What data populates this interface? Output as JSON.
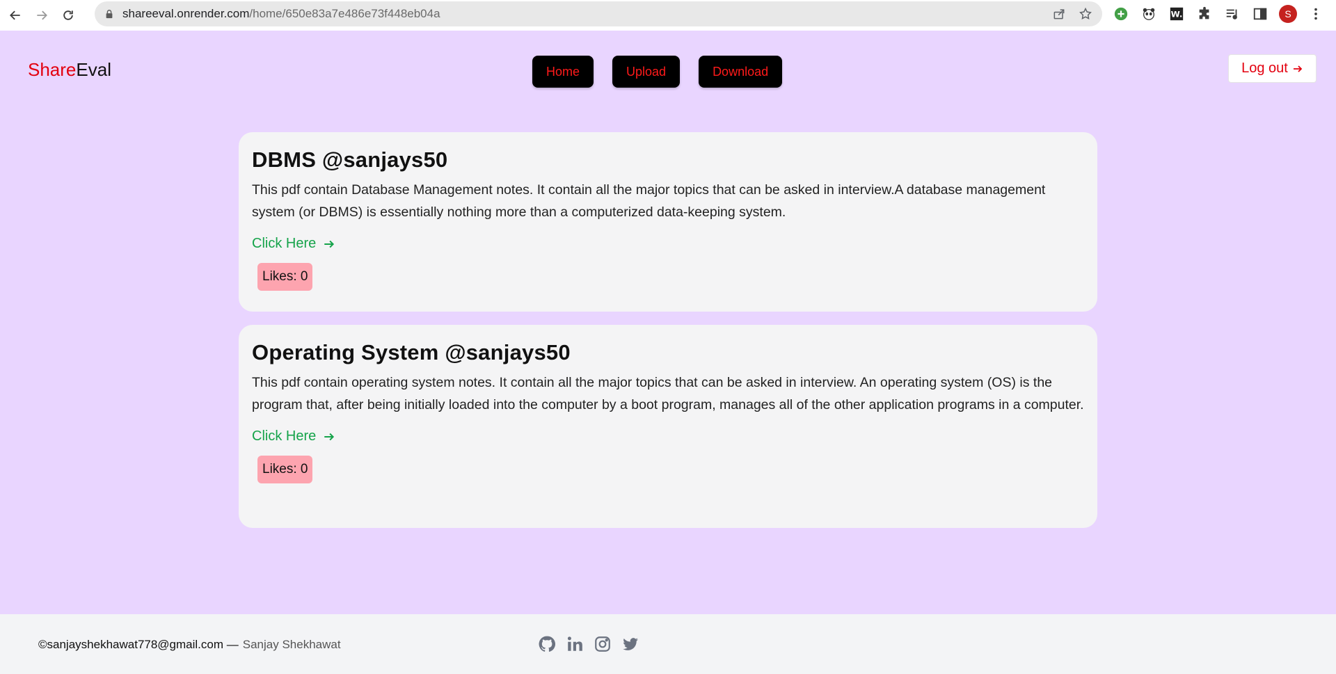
{
  "browser": {
    "url_host": "shareeval.onrender.com",
    "url_path": "/home/650e83a7e486e73f448eb04a",
    "avatar_letter": "S"
  },
  "header": {
    "logo_part1": "Share",
    "logo_part2": "Eval",
    "nav": [
      "Home",
      "Upload",
      "Download"
    ],
    "logout_label": "Log out"
  },
  "cards": [
    {
      "title": "DBMS @sanjays50",
      "description": "This pdf contain Database Management notes. It contain all the major topics that can be asked in interview.A database management system (or DBMS) is essentially nothing more than a computerized data-keeping system.",
      "link_label": "Click Here",
      "likes_label": "Likes: 0"
    },
    {
      "title": "Operating System @sanjays50",
      "description": "This pdf contain operating system notes. It contain all the major topics that can be asked in interview. An operating system (OS) is the program that, after being initially loaded into the computer by a boot program, manages all of the other application programs in a computer.",
      "link_label": "Click Here",
      "likes_label": "Likes: 0"
    }
  ],
  "footer": {
    "email": "©sanjayshekhawat778@gmail.com —",
    "author": "Sanjay Shekhawat",
    "social_icons": [
      "github-icon",
      "linkedin-icon",
      "instagram-icon",
      "twitter-icon"
    ]
  },
  "colors": {
    "background": "#e9d5ff",
    "accent_red": "#e3000f",
    "link_green": "#15a34a",
    "likes_badge": "#fda4af"
  }
}
